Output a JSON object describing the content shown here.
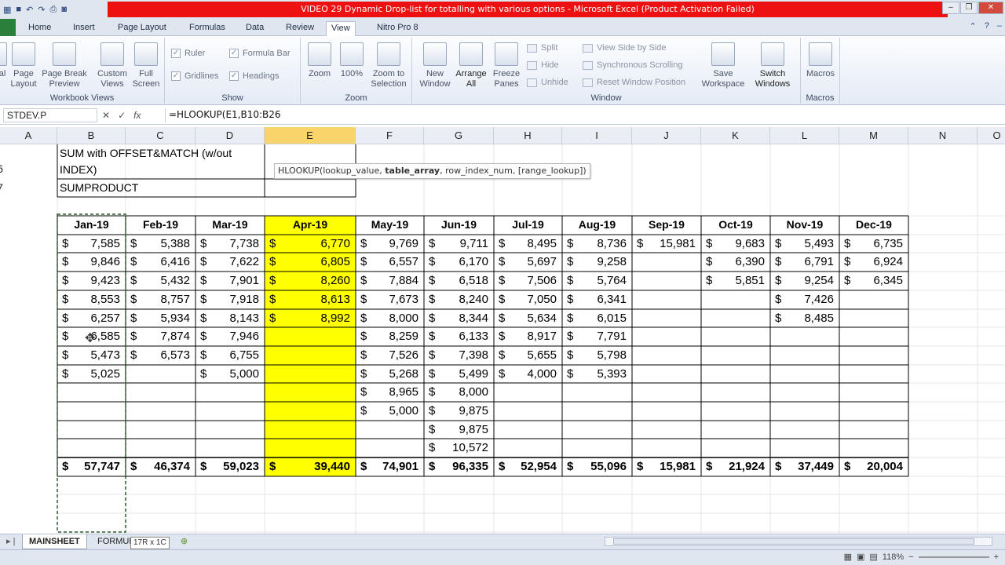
{
  "titlebar": {
    "title": "VIDEO 29 Dynamic Drop-list for totalling with various options  -  Microsoft Excel (Product Activation Failed)"
  },
  "ribbon_tabs": [
    "Home",
    "Insert",
    "Page Layout",
    "Formulas",
    "Data",
    "Review",
    "View",
    "Nitro Pro 8"
  ],
  "ribbon": {
    "workbook_views": {
      "label": "Workbook Views",
      "normal": "al",
      "page_layout": [
        "Page",
        "Layout"
      ],
      "page_break": [
        "Page Break",
        "Preview"
      ],
      "custom_views": [
        "Custom",
        "Views"
      ],
      "full_screen": [
        "Full",
        "Screen"
      ]
    },
    "show": {
      "label": "Show",
      "ruler": "Ruler",
      "formula_bar": "Formula Bar",
      "gridlines": "Gridlines",
      "headings": "Headings"
    },
    "zoom": {
      "label": "Zoom",
      "zoom": "Zoom",
      "hundred": "100%",
      "zoom_selection": [
        "Zoom to",
        "Selection"
      ]
    },
    "window": {
      "label": "Window",
      "new_window": [
        "New",
        "Window"
      ],
      "arrange_all": [
        "Arrange",
        "All"
      ],
      "freeze_panes": [
        "Freeze",
        "Panes"
      ],
      "split": "Split",
      "hide": "Hide",
      "unhide": "Unhide",
      "side_by_side": "View Side by Side",
      "sync_scroll": "Synchronous Scrolling",
      "reset_pos": "Reset Window Position",
      "save_ws": [
        "Save",
        "Workspace"
      ],
      "switch_win": [
        "Switch",
        "Windows"
      ]
    },
    "macros": {
      "label": "Macros",
      "macros": "Macros"
    }
  },
  "formula_bar": {
    "name_box": "STDEV.P",
    "formula": "=HLOOKUP(E1,B10:B26"
  },
  "columns": [
    "A",
    "B",
    "C",
    "D",
    "E",
    "F",
    "G",
    "H",
    "I",
    "J",
    "K",
    "L",
    "M",
    "N",
    "O"
  ],
  "rows": {
    "r6": "6",
    "r7": "7"
  },
  "labels": {
    "b6_line1": "SUM with OFFSET&MATCH (w/out",
    "b6_line2": "INDEX)",
    "b7": "SUMPRODUCT"
  },
  "tooltip": {
    "pre": "HLOOKUP(lookup_value, ",
    "bold": "table_array",
    "post": ", row_index_num, [range_lookup])"
  },
  "table": {
    "headers": [
      "Jan-19",
      "Feb-19",
      "Mar-19",
      "Apr-19",
      "May-19",
      "Jun-19",
      "Jul-19",
      "Aug-19",
      "Sep-19",
      "Oct-19",
      "Nov-19",
      "Dec-19"
    ],
    "data": [
      [
        "7,585",
        "5,388",
        "7,738",
        "6,770",
        "9,769",
        "9,711",
        "8,495",
        "8,736",
        "15,981",
        "9,683",
        "5,493",
        "6,735"
      ],
      [
        "9,846",
        "6,416",
        "7,622",
        "6,805",
        "6,557",
        "6,170",
        "5,697",
        "9,258",
        "",
        "6,390",
        "6,791",
        "6,924"
      ],
      [
        "9,423",
        "5,432",
        "7,901",
        "8,260",
        "7,884",
        "6,518",
        "7,506",
        "5,764",
        "",
        "5,851",
        "9,254",
        "6,345"
      ],
      [
        "8,553",
        "8,757",
        "7,918",
        "8,613",
        "7,673",
        "8,240",
        "7,050",
        "6,341",
        "",
        "",
        "7,426",
        ""
      ],
      [
        "6,257",
        "5,934",
        "8,143",
        "8,992",
        "8,000",
        "8,344",
        "5,634",
        "6,015",
        "",
        "",
        "8,485",
        ""
      ],
      [
        "6,585",
        "7,874",
        "7,946",
        "",
        "8,259",
        "6,133",
        "8,917",
        "7,791",
        "",
        "",
        "",
        ""
      ],
      [
        "5,473",
        "6,573",
        "6,755",
        "",
        "7,526",
        "7,398",
        "5,655",
        "5,798",
        "",
        "",
        "",
        ""
      ],
      [
        "5,025",
        "",
        "5,000",
        "",
        "5,268",
        "5,499",
        "4,000",
        "5,393",
        "",
        "",
        "",
        ""
      ],
      [
        "",
        "",
        "",
        "",
        "8,965",
        "8,000",
        "",
        "",
        "",
        "",
        "",
        ""
      ],
      [
        "",
        "",
        "",
        "",
        "5,000",
        "9,875",
        "",
        "",
        "",
        "",
        "",
        ""
      ],
      [
        "",
        "",
        "",
        "",
        "",
        "9,875",
        "",
        "",
        "",
        "",
        "",
        ""
      ],
      [
        "",
        "",
        "",
        "",
        "",
        "10,572",
        "",
        "",
        "",
        "",
        "",
        ""
      ]
    ],
    "totals": [
      "57,747",
      "46,374",
      "59,023",
      "39,440",
      "74,901",
      "96,335",
      "52,954",
      "55,096",
      "15,981",
      "21,924",
      "37,449",
      "20,004"
    ],
    "currency": "$"
  },
  "sheets": {
    "active": "MAINSHEET",
    "other": "FORMUL",
    "size_tip": "17R x 1C"
  },
  "status": {
    "zoom": "118%"
  },
  "colors": {
    "highlight": "#ffff00",
    "title_red": "#ee1111",
    "selected_header": "#f9d46a"
  }
}
